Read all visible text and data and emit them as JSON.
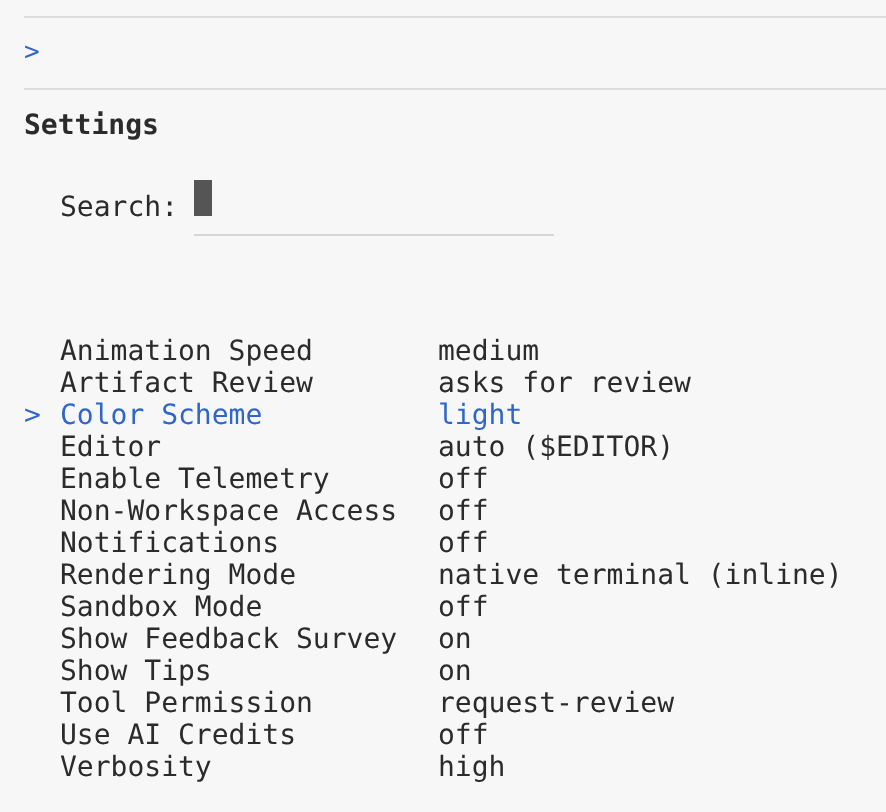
{
  "prompt": ">",
  "title": "Settings",
  "search": {
    "label": "Search:"
  },
  "marker": ">",
  "settings": [
    {
      "name": "Animation Speed",
      "value": "medium",
      "selected": false
    },
    {
      "name": "Artifact Review",
      "value": "asks for review",
      "selected": false
    },
    {
      "name": "Color Scheme",
      "value": "light",
      "selected": true
    },
    {
      "name": "Editor",
      "value": "auto ($EDITOR)",
      "selected": false
    },
    {
      "name": "Enable Telemetry",
      "value": "off",
      "selected": false
    },
    {
      "name": "Non-Workspace Access",
      "value": "off",
      "selected": false
    },
    {
      "name": "Notifications",
      "value": "off",
      "selected": false
    },
    {
      "name": "Rendering Mode",
      "value": "native terminal (inline)",
      "selected": false
    },
    {
      "name": "Sandbox Mode",
      "value": "off",
      "selected": false
    },
    {
      "name": "Show Feedback Survey",
      "value": "on",
      "selected": false
    },
    {
      "name": "Show Tips",
      "value": "on",
      "selected": false
    },
    {
      "name": "Tool Permission",
      "value": "request-review",
      "selected": false
    },
    {
      "name": "Use AI Credits",
      "value": "off",
      "selected": false
    },
    {
      "name": "Verbosity",
      "value": "high",
      "selected": false
    }
  ]
}
